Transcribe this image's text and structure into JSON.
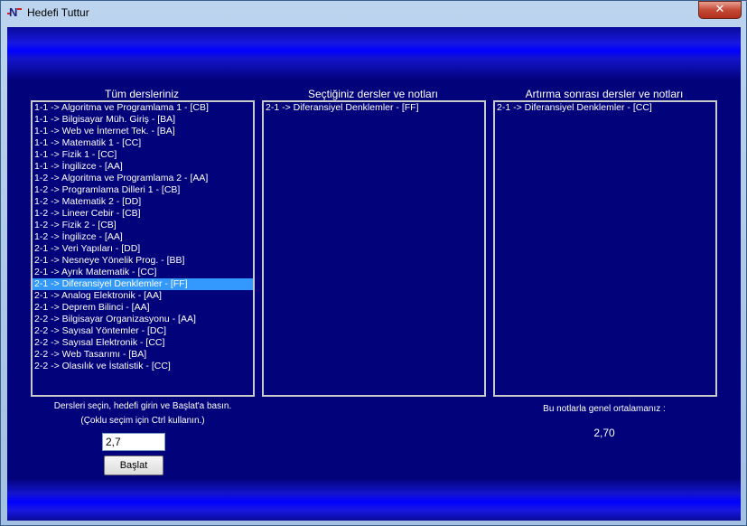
{
  "window": {
    "title": "Hedefi Tuttur",
    "close_glyph": "✕",
    "icon_letter": "N"
  },
  "columns": {
    "all_title": "Tüm dersleriniz",
    "selected_title": "Seçtiğiniz dersler ve notları",
    "raised_title": "Artırma sonrası dersler ve notları"
  },
  "all_courses": [
    "1-1 -> Algoritma ve Programlama 1 - [CB]",
    "1-1 -> Bilgisayar Müh. Giriş - [BA]",
    "1-1 -> Web ve İnternet Tek. - [BA]",
    "1-1 -> Matematik 1 - [CC]",
    "1-1 -> Fizik 1 - [CC]",
    "1-1 -> İngilizce - [AA]",
    "1-2 -> Algoritma ve Programlama 2 - [AA]",
    "1-2 -> Programlama Dilleri 1 - [CB]",
    "1-2 -> Matematik 2 - [DD]",
    "1-2 -> Lineer Cebir - [CB]",
    "1-2 -> Fizik 2 - [CB]",
    "1-2 -> İngilizce - [AA]",
    "2-1 -> Veri Yapıları - [DD]",
    "2-1 -> Nesneye Yönelik Prog. - [BB]",
    "2-1 -> Ayrık Matematik - [CC]",
    "2-1 -> Diferansiyel Denklemler - [FF]",
    "2-1 -> Analog Elektronik - [AA]",
    "2-1 -> Deprem Bilinci - [AA]",
    "2-2 -> Bilgisayar Organizasyonu - [AA]",
    "2-2 -> Sayısal Yöntemler - [DC]",
    "2-2 -> Sayısal Elektronik - [CC]",
    "2-2 -> Web Tasarımı - [BA]",
    "2-2 -> Olasılık ve İstatistik - [CC]"
  ],
  "selected_index": 15,
  "selected_courses": [
    "2-1 -> Diferansiyel Denklemler - [FF]"
  ],
  "raised_courses": [
    "2-1 -> Diferansiyel Denklemler - [CC]"
  ],
  "instructions": {
    "line1": "Dersleri seçin, hedefi girin ve Başlat'a basın.",
    "line2": "(Çoklu seçim için Ctrl kullanın.)"
  },
  "target": {
    "value": "2,7"
  },
  "start_button": {
    "label": "Başlat"
  },
  "result": {
    "label": "Bu notlarla genel ortalamanız :",
    "value": "2,70"
  }
}
